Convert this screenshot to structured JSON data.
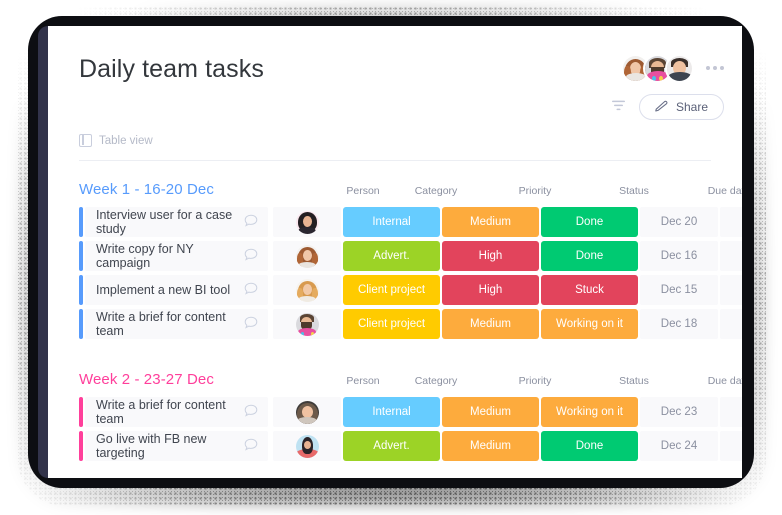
{
  "app": {
    "title": "Daily team tasks",
    "view_tab": "Table view",
    "share_label": "Share",
    "filter_icon": "filter-icon",
    "share_icon": "pen-edit-icon",
    "more_icon": "more-options-icon",
    "add_column_label": "+"
  },
  "columns": {
    "person": "Person",
    "category": "Category",
    "priority": "Priority",
    "status": "Status",
    "due_date": "Due date"
  },
  "colors": {
    "accent_blue": "#579bfc",
    "accent_pink": "#ff3f9b",
    "group1_title": "#579bfc",
    "group2_title": "#ff3f9b",
    "internal": "#66ccff",
    "advert": "#9cd326",
    "client_project": "#ffcb00",
    "medium": "#fdab3d",
    "high": "#e2445c",
    "done": "#00ca72",
    "stuck": "#e2445c",
    "working_on_it": "#fdab3d",
    "title_text": "#33373c",
    "muted_text": "#8b90a0",
    "cell_bg": "#f9f9fb",
    "rail": "#32334a"
  },
  "groups": [
    {
      "title": "Week 1 - 16-20 Dec",
      "title_color": "#579bfc",
      "accent": "#579bfc",
      "rows": [
        {
          "task": "Interview user for a case study",
          "person": "avatar-dark-hair-woman",
          "category": "Internal",
          "category_color": "#66ccff",
          "priority": "Medium",
          "priority_color": "#fdab3d",
          "status": "Done",
          "status_color": "#00ca72",
          "due_date": "Dec 20"
        },
        {
          "task": "Write copy for NY campaign",
          "person": "avatar-red-hair-woman",
          "category": "Advert.",
          "category_color": "#9cd326",
          "priority": "High",
          "priority_color": "#e2445c",
          "status": "Done",
          "status_color": "#00ca72",
          "due_date": "Dec 16"
        },
        {
          "task": "Implement a new BI tool",
          "person": "avatar-blonde-woman",
          "category": "Client project",
          "category_color": "#ffcb00",
          "priority": "High",
          "priority_color": "#e2445c",
          "status": "Stuck",
          "status_color": "#e2445c",
          "due_date": "Dec 15"
        },
        {
          "task": "Write a brief for content team",
          "person": "avatar-bearded-man",
          "category": "Client project",
          "category_color": "#ffcb00",
          "priority": "Medium",
          "priority_color": "#fdab3d",
          "status": "Working on it",
          "status_color": "#fdab3d",
          "due_date": "Dec 18"
        }
      ]
    },
    {
      "title": "Week 2 - 23-27 Dec",
      "title_color": "#ff3f9b",
      "accent": "#ff3f9b",
      "rows": [
        {
          "task": "Write a brief for content team",
          "person": "avatar-smiling-woman",
          "category": "Internal",
          "category_color": "#66ccff",
          "priority": "Medium",
          "priority_color": "#fdab3d",
          "status": "Working on it",
          "status_color": "#fdab3d",
          "due_date": "Dec 23"
        },
        {
          "task": "Go live with FB new targeting",
          "person": "avatar-dark-portrait-woman",
          "category": "Advert.",
          "category_color": "#9cd326",
          "priority": "Medium",
          "priority_color": "#fdab3d",
          "status": "Done",
          "status_color": "#00ca72",
          "due_date": "Dec 24"
        }
      ]
    }
  ],
  "header_avatars": [
    "avatar-red-hair-woman",
    "avatar-bearded-man",
    "avatar-short-hair-man"
  ]
}
